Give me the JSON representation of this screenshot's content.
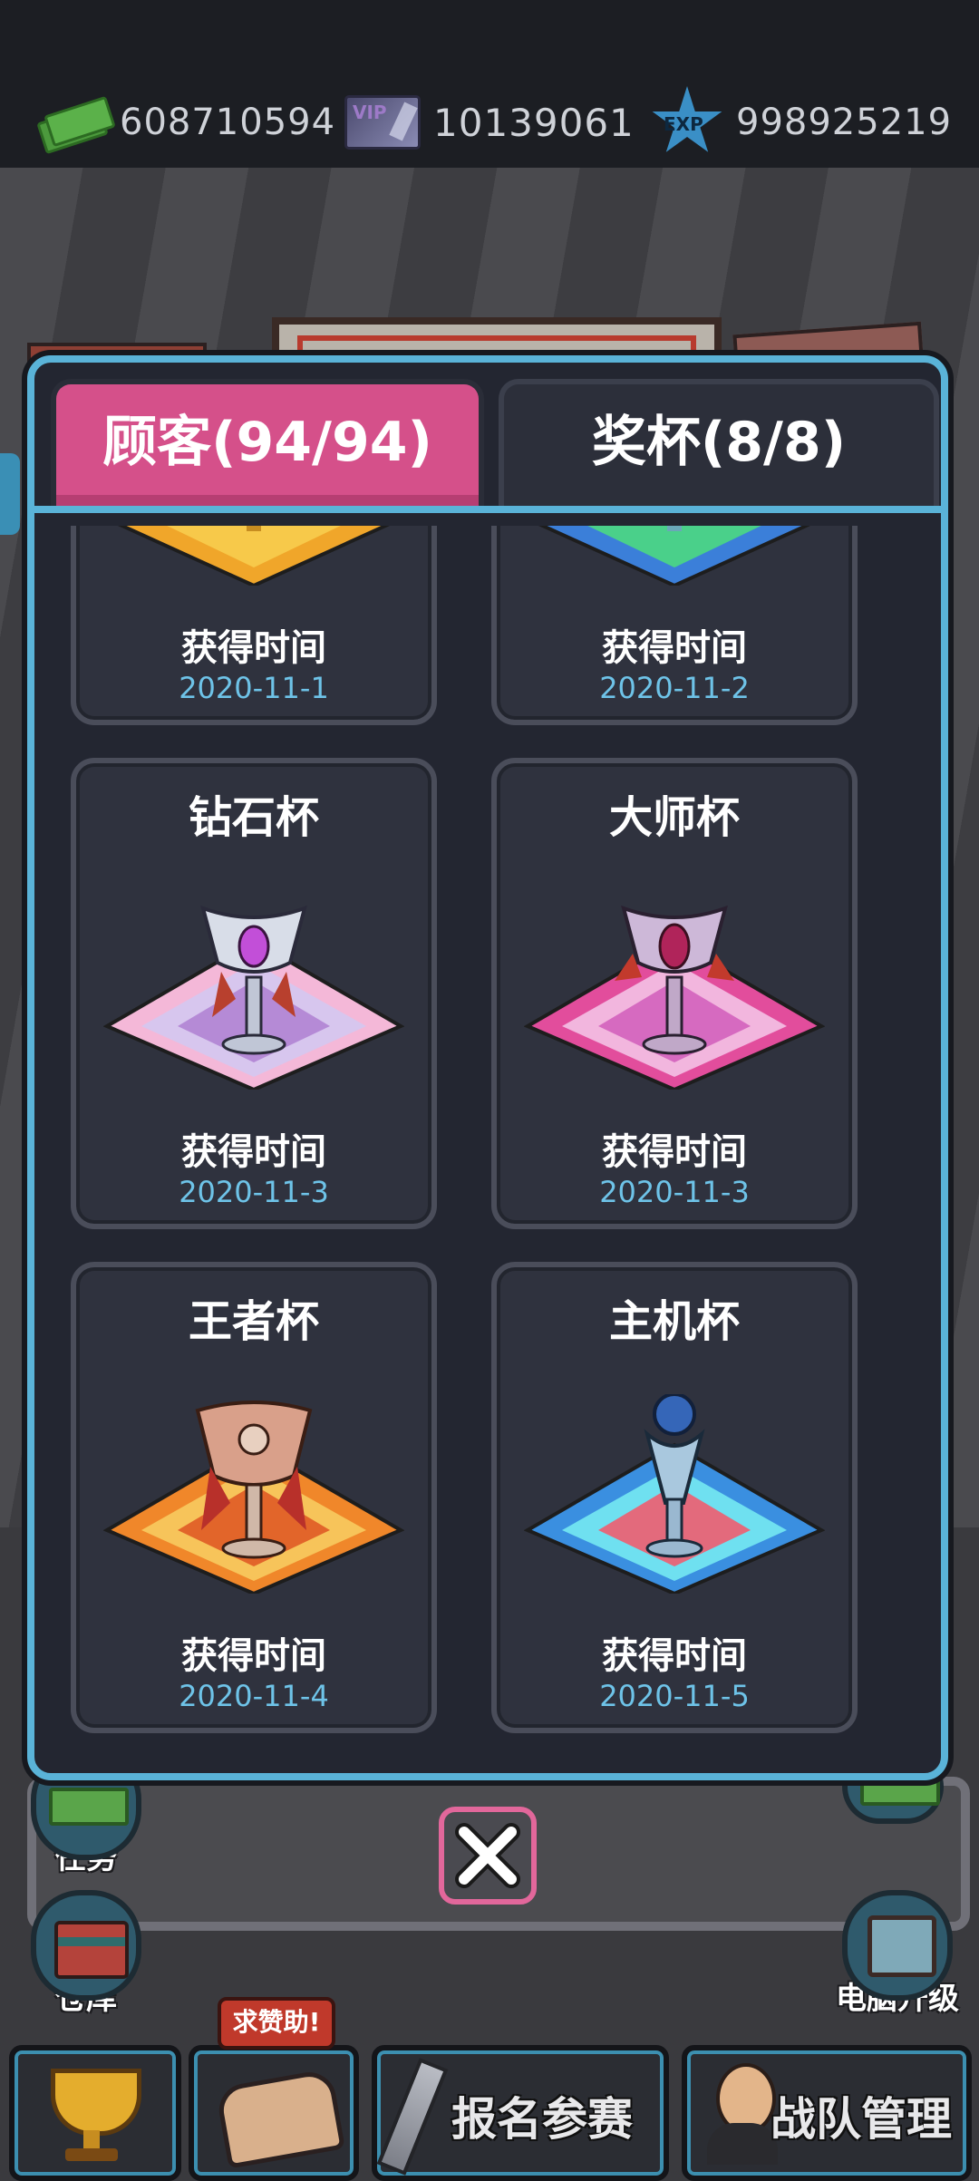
{
  "status": {
    "cash": "608710594",
    "vip": "10139061",
    "exp": "998925219",
    "vip_icon_text": "VIP",
    "exp_icon_text": "EXP"
  },
  "modal": {
    "tabs": [
      {
        "label": "顾客(94/94)",
        "active": true,
        "color": "#d5508a"
      },
      {
        "label": "奖杯(8/8)",
        "active": false
      }
    ],
    "border_color": "#5ab3d8",
    "trophies": [
      {
        "name": "",
        "time_label": "获得时间",
        "date": "2020-11-1"
      },
      {
        "name": "",
        "time_label": "获得时间",
        "date": "2020-11-2"
      },
      {
        "name": "钻石杯",
        "time_label": "获得时间",
        "date": "2020-11-3"
      },
      {
        "name": "大师杯",
        "time_label": "获得时间",
        "date": "2020-11-3"
      },
      {
        "name": "王者杯",
        "time_label": "获得时间",
        "date": "2020-11-4"
      },
      {
        "name": "主机杯",
        "time_label": "获得时间",
        "date": "2020-11-5"
      }
    ],
    "close_icon": "close-icon"
  },
  "background": {
    "side_buttons": [
      {
        "label": "任务",
        "icon": "money-icon"
      },
      {
        "label": "仓库",
        "icon": "chest-icon"
      },
      {
        "label": "电脑升级",
        "icon": "monitor-icon"
      }
    ]
  },
  "bottom_nav": {
    "help_tag": "求赞助!",
    "register_label": "报名参赛",
    "team_label": "战队管理"
  },
  "colors": {
    "date_text": "#6ec3e8",
    "accent_pink": "#e2679b"
  }
}
